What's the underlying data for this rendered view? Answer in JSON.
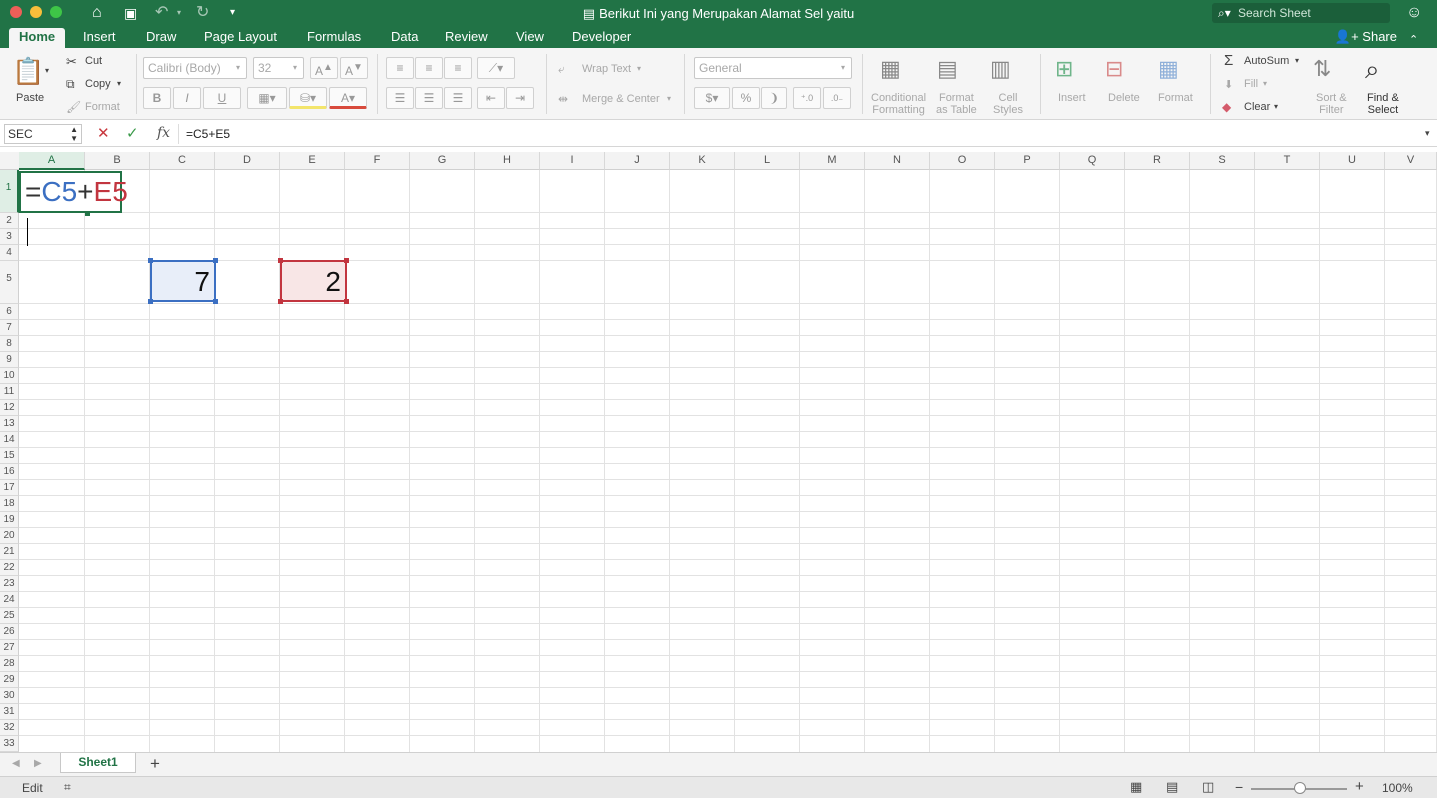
{
  "window": {
    "title": "Berikut Ini yang Merupakan Alamat Sel yaitu",
    "search_placeholder": "Search Sheet"
  },
  "tabs": [
    "Home",
    "Insert",
    "Draw",
    "Page Layout",
    "Formulas",
    "Data",
    "Review",
    "View",
    "Developer"
  ],
  "share_label": "Share",
  "ribbon": {
    "clipboard": {
      "paste": "Paste",
      "cut": "Cut",
      "copy": "Copy",
      "format": "Format"
    },
    "font": {
      "name": "Calibri (Body)",
      "size": "32",
      "bold": "B",
      "italic": "I",
      "underline": "U"
    },
    "alignment": {
      "wrap": "Wrap Text",
      "merge": "Merge & Center"
    },
    "number": {
      "format": "General",
      "currency": "$",
      "percent": "%"
    },
    "styles": {
      "cond1": "Conditional",
      "cond2": "Formatting",
      "fmt1": "Format",
      "fmt2": "as Table",
      "cell1": "Cell",
      "cell2": "Styles"
    },
    "cells": {
      "insert": "Insert",
      "delete": "Delete",
      "format": "Format"
    },
    "editing": {
      "autosum": "AutoSum",
      "fill": "Fill",
      "clear": "Clear",
      "sort1": "Sort &",
      "sort2": "Filter",
      "find1": "Find &",
      "find2": "Select"
    }
  },
  "formula_bar": {
    "name_box": "SEC",
    "fx": "fx",
    "formula": "=C5+E5"
  },
  "columns": [
    "A",
    "B",
    "C",
    "D",
    "E",
    "F",
    "G",
    "H",
    "I",
    "J",
    "K",
    "L",
    "M",
    "N",
    "O",
    "P",
    "Q",
    "R",
    "S",
    "T",
    "U",
    "V"
  ],
  "rows": [
    "1",
    "2",
    "3",
    "4",
    "5",
    "6",
    "7",
    "8",
    "9",
    "10",
    "11",
    "12",
    "13",
    "14",
    "15",
    "16",
    "17",
    "18",
    "19",
    "20",
    "21",
    "22",
    "23",
    "24",
    "25",
    "26",
    "27",
    "28",
    "29",
    "30",
    "31",
    "32",
    "33"
  ],
  "cells": {
    "a1": {
      "eq": "=",
      "ref1": "C5",
      "plus": "+",
      "ref2": "E5"
    },
    "c5": "7",
    "e5": "2"
  },
  "sheet_tabs": [
    "Sheet1"
  ],
  "status": {
    "mode": "Edit",
    "zoom": "100%"
  },
  "colors": {
    "accent": "#217346",
    "ref_blue": "#3b6fc2",
    "ref_red": "#c2353f"
  }
}
